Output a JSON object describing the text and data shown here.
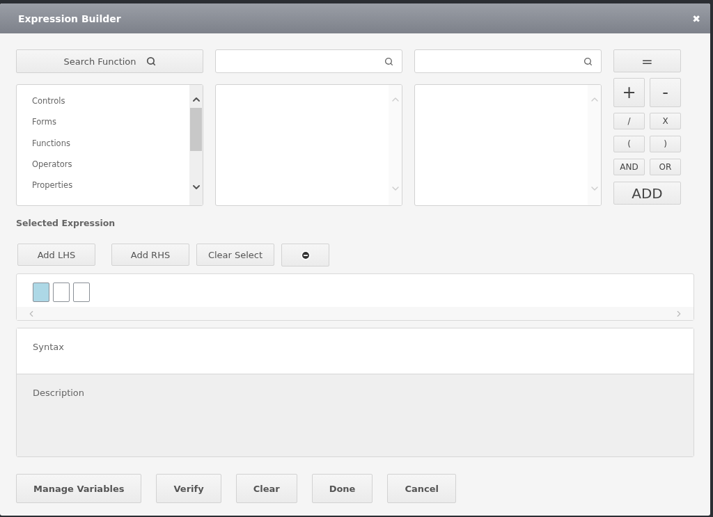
{
  "dialog": {
    "title": "Expression Builder",
    "close": "✖"
  },
  "search_button": {
    "label": "Search Function"
  },
  "search_fields": [
    {
      "kind": "search"
    },
    {
      "kind": "search"
    }
  ],
  "categories": [
    {
      "label": "Controls",
      "selected": false
    },
    {
      "label": "Forms",
      "selected": false
    },
    {
      "label": "Functions",
      "selected": false
    },
    {
      "label": "Operators",
      "selected": false
    },
    {
      "label": "Properties",
      "selected": false
    }
  ],
  "operators": [
    {
      "kind": "wide",
      "label": "="
    },
    {
      "kind": "large",
      "label": "+"
    },
    {
      "kind": "large",
      "label": "-"
    },
    {
      "kind": "small",
      "label": "/"
    },
    {
      "kind": "small",
      "label": "X"
    },
    {
      "kind": "small",
      "label": "("
    },
    {
      "kind": "small",
      "label": ")"
    },
    {
      "kind": "small",
      "label": "AND"
    },
    {
      "kind": "small",
      "label": "OR"
    },
    {
      "kind": "add",
      "label": "ADD"
    }
  ],
  "selected_expression": {
    "label": "Selected Expression",
    "buttons": [
      {
        "kind": "text",
        "label": "Add LHS"
      },
      {
        "kind": "text",
        "label": "Add RHS"
      },
      {
        "kind": "text",
        "label": "Clear Select"
      },
      {
        "kind": "remove"
      }
    ],
    "slots": [
      {
        "selected": true
      },
      {
        "selected": false
      },
      {
        "selected": false
      }
    ]
  },
  "syntax": {
    "label": "Syntax"
  },
  "description": {
    "label": "Description"
  },
  "footer_buttons": [
    "Manage Variables",
    "Verify",
    "Clear",
    "Done",
    "Cancel"
  ]
}
